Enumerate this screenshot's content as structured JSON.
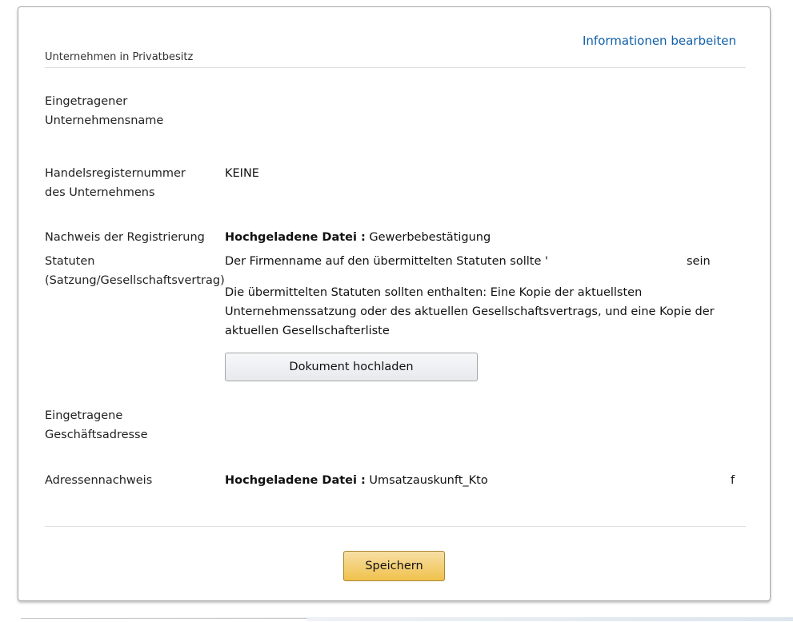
{
  "header": {
    "edit_link": "Informationen bearbeiten",
    "company_type": "Unternehmen in Privatbesitz"
  },
  "fields": {
    "registered_name": {
      "label": "Eingetragener Unternehmensname",
      "value": ""
    },
    "registry_number": {
      "label": "Handelsregisternummer des Unternehmens",
      "value": "KEINE"
    },
    "registration_proof": {
      "label": "Nachweis der Registrierung",
      "file_prefix": "Hochgeladene Datei :",
      "file_name": "Gewerbebestätigung"
    },
    "statutes": {
      "label": "Statuten (Satzung/Gesellschaftsvertrag)",
      "notice_start": "Der Firmenname auf den übermittelten Statuten sollte '",
      "notice_end": "sein",
      "requirements": "Die übermittelten Statuten sollten enthalten: Eine Kopie der aktuellsten Unternehmenssatzung oder des aktuellen Gesellschaftsvertrags, und eine Kopie der aktuellen Gesellschafterliste",
      "upload_button": "Dokument hochladen"
    },
    "registered_address": {
      "label": "Eingetragene Geschäftsadresse",
      "value": ""
    },
    "address_proof": {
      "label": "Adressennachweis",
      "file_prefix": "Hochgeladene Datei :",
      "file_name": "Umsatzauskunft_Kto",
      "trailing": "f"
    }
  },
  "footer": {
    "save_button": "Speichern"
  },
  "colors": {
    "link": "#0f5fa8",
    "save_button": "#f0c14b",
    "border": "#a8a8a8"
  }
}
